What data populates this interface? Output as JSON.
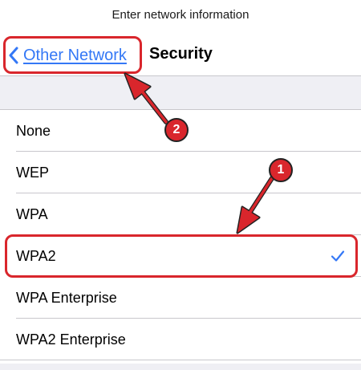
{
  "header": {
    "prompt": "Enter network information",
    "back_label": "Other Network",
    "title": "Security"
  },
  "security_options": [
    {
      "label": "None",
      "selected": false
    },
    {
      "label": "WEP",
      "selected": false
    },
    {
      "label": "WPA",
      "selected": false
    },
    {
      "label": "WPA2",
      "selected": true
    },
    {
      "label": "WPA Enterprise",
      "selected": false
    },
    {
      "label": "WPA2 Enterprise",
      "selected": false
    }
  ],
  "annotations": {
    "badge_1": "1",
    "badge_2": "2"
  },
  "colors": {
    "accent": "#3478f6",
    "annotation": "#d9262c",
    "group_background": "#efeff4"
  },
  "icons": {
    "back": "chevron-left-icon",
    "selected": "checkmark-icon"
  }
}
